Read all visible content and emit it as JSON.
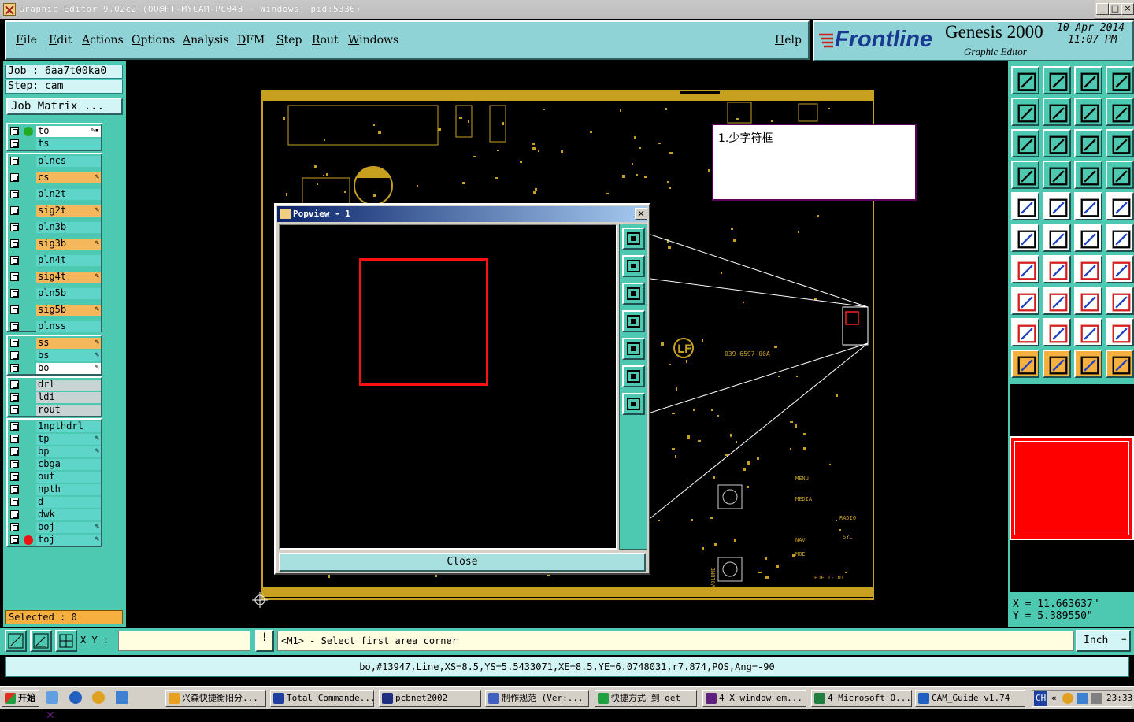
{
  "window": {
    "title": "Graphic Editor 9.02c2  (OO@HT-MYCAM-PC048 - Windows, pid:5336)",
    "controls": [
      "_",
      "□",
      "×"
    ]
  },
  "menu": {
    "items": [
      "File",
      "Edit",
      "Actions",
      "Options",
      "Analysis",
      "DFM",
      "Step",
      "Rout",
      "Windows"
    ],
    "help": "Help"
  },
  "brand": {
    "logo": "Frontline",
    "product": "Genesis 2000",
    "subtitle": "Graphic Editor",
    "date": "10 Apr 2014",
    "time": "11:07 PM"
  },
  "job": {
    "job_label": "Job :  6aa7t00ka0",
    "step_label": "Step:  cam",
    "matrix_button": "Job Matrix ..."
  },
  "layers": {
    "group1": [
      {
        "name": "to",
        "style": "white",
        "dot": "#22aa22",
        "pen": "✎▪"
      },
      {
        "name": "ts",
        "style": "teal"
      }
    ],
    "group2": [
      {
        "name": "plncs",
        "style": "teal"
      },
      {
        "name": "cs",
        "style": "orange",
        "pen": "✎"
      },
      {
        "name": "pln2t",
        "style": "teal"
      },
      {
        "name": "sig2t",
        "style": "orange",
        "pen": "✎"
      },
      {
        "name": "pln3b",
        "style": "teal"
      },
      {
        "name": "sig3b",
        "style": "orange",
        "pen": "✎"
      },
      {
        "name": "pln4t",
        "style": "teal"
      },
      {
        "name": "sig4t",
        "style": "orange",
        "pen": "✎"
      },
      {
        "name": "pln5b",
        "style": "teal"
      },
      {
        "name": "sig5b",
        "style": "orange",
        "pen": "✎"
      },
      {
        "name": "plnss",
        "style": "teal"
      }
    ],
    "group3": [
      {
        "name": "ss",
        "style": "orange",
        "pen": "✎"
      },
      {
        "name": "bs",
        "style": "teal",
        "pen": "✎"
      },
      {
        "name": "bo",
        "style": "white",
        "pen": "✎"
      }
    ],
    "group4": [
      {
        "name": "drl",
        "style": "gray"
      },
      {
        "name": "ldi",
        "style": "gray"
      },
      {
        "name": "rout",
        "style": "gray"
      }
    ],
    "group5": [
      {
        "name": "1npthdrl",
        "style": "teal"
      },
      {
        "name": "tp",
        "style": "teal",
        "pen": "✎"
      },
      {
        "name": "bp",
        "style": "teal",
        "pen": "✎"
      },
      {
        "name": "cbga",
        "style": "teal"
      },
      {
        "name": "out",
        "style": "teal"
      },
      {
        "name": "npth",
        "style": "teal"
      },
      {
        "name": "d",
        "style": "teal"
      },
      {
        "name": "dwk",
        "style": "teal"
      },
      {
        "name": "boj",
        "style": "teal",
        "pen": "✎"
      },
      {
        "name": "toj",
        "style": "teal",
        "dot": "#ee1111",
        "pen": "✎"
      }
    ]
  },
  "selected": "Selected : 0",
  "popview": {
    "title": "Popview - 1",
    "close_label": "Close"
  },
  "note": {
    "text": "1.少字符框"
  },
  "board_labels": {
    "part_number": "039-6597-00A",
    "labels": [
      "MENU",
      "MEDIA",
      "RADIO",
      "SYC",
      "NAV",
      "MOE",
      "EJECT-INT",
      "VOLUME"
    ]
  },
  "coords": {
    "x": "X  =  11.663637\"",
    "y": "Y  =  5.389550\""
  },
  "command": {
    "xy_label": "X Y :",
    "xy_value": "",
    "prompt": "<M1> - Select first area corner",
    "unit": "Inch"
  },
  "status": "bo,#13947,Line,XS=8.5,YS=5.5433071,XE=8.5,YE=6.0748031,r7.874,POS,Ang=-90",
  "taskbar": {
    "start": "开始",
    "tasks": [
      {
        "label": "兴森快捷衡阳分...",
        "color": "#e8a020"
      },
      {
        "label": "Total Commande...",
        "color": "#2040a0"
      },
      {
        "label": "pcbnet2002",
        "color": "#203080"
      },
      {
        "label": "制作规范 (Ver:...",
        "color": "#4060c0"
      },
      {
        "label": "快捷方式 到 get",
        "color": "#20a040"
      },
      {
        "label": "4 X window em...",
        "color": "#602080"
      },
      {
        "label": "4 Microsoft O...",
        "color": "#208040"
      },
      {
        "label": "CAM_Guide v1.74",
        "color": "#2060c0"
      }
    ],
    "tray_lang": "CH",
    "clock": "23:33"
  },
  "colors": {
    "panel": "#4cc9b0",
    "menu_bg": "#8fd3d6",
    "copper": "#c8a020",
    "highlight": "#ff0000"
  }
}
